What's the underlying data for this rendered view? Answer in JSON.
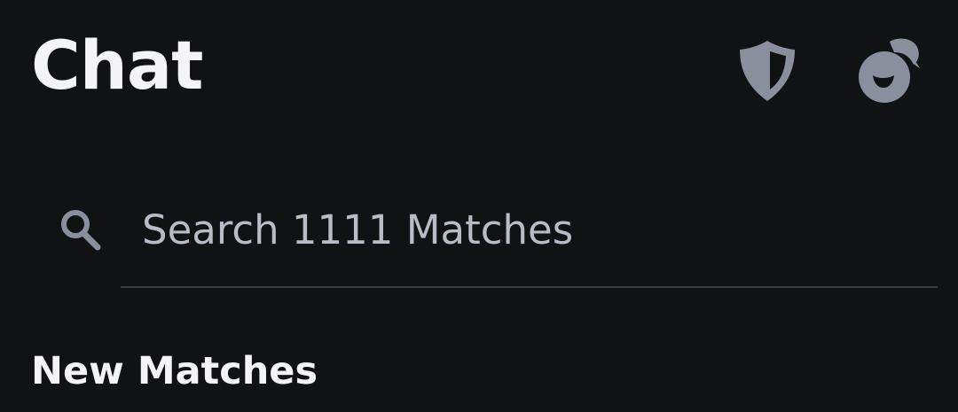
{
  "header": {
    "title": "Chat",
    "icons": {
      "shield": "shield-icon",
      "chat": "chat-bubbles-icon"
    }
  },
  "search": {
    "placeholder": "Search 1111 Matches",
    "icon": "search-icon"
  },
  "sections": {
    "new_matches": "New Matches"
  },
  "colors": {
    "background": "#111214",
    "title": "#f4f4f7",
    "icon": "#8a8f9e",
    "placeholder": "#b9bcc6",
    "divider": "#3b3e45"
  }
}
